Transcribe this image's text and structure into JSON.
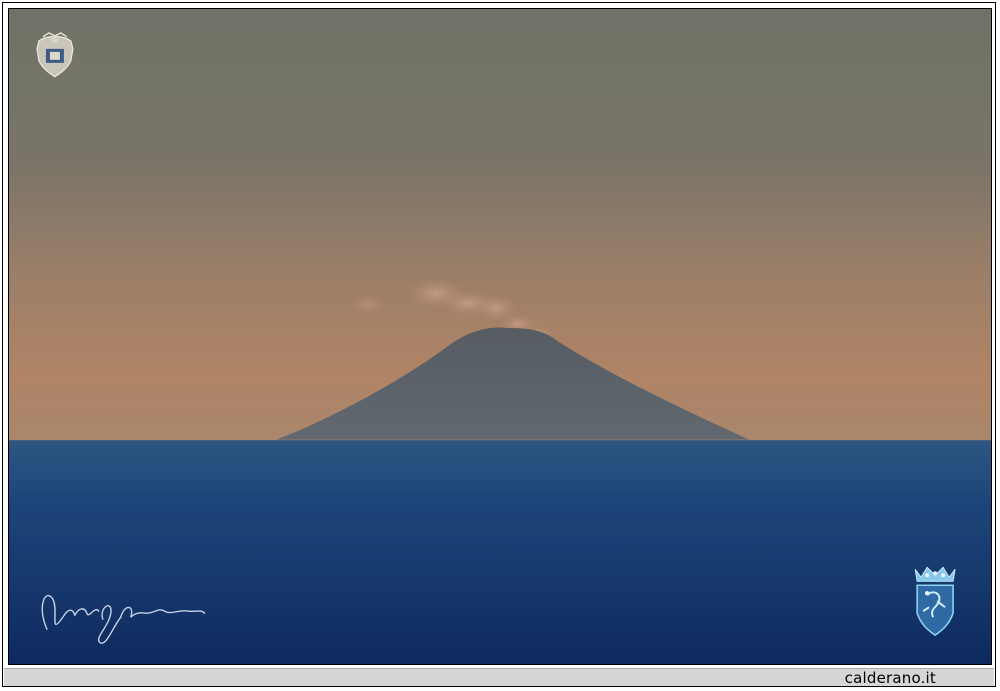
{
  "site": {
    "label": "calderano.it"
  },
  "icons": {
    "top_left": "coat-of-arms-icon",
    "bottom_right": "crowned-crest-icon",
    "bottom_left": "signature-icon"
  },
  "colors": {
    "sky_top": "#707468",
    "sky_horizon": "#b08466",
    "mountain": "#5b6165",
    "sea_horizon": "#2d5480",
    "sea_bottom": "#0f2c63",
    "crest_blue": "#7ec8ee",
    "caption_bg": "#d6d6d6"
  }
}
